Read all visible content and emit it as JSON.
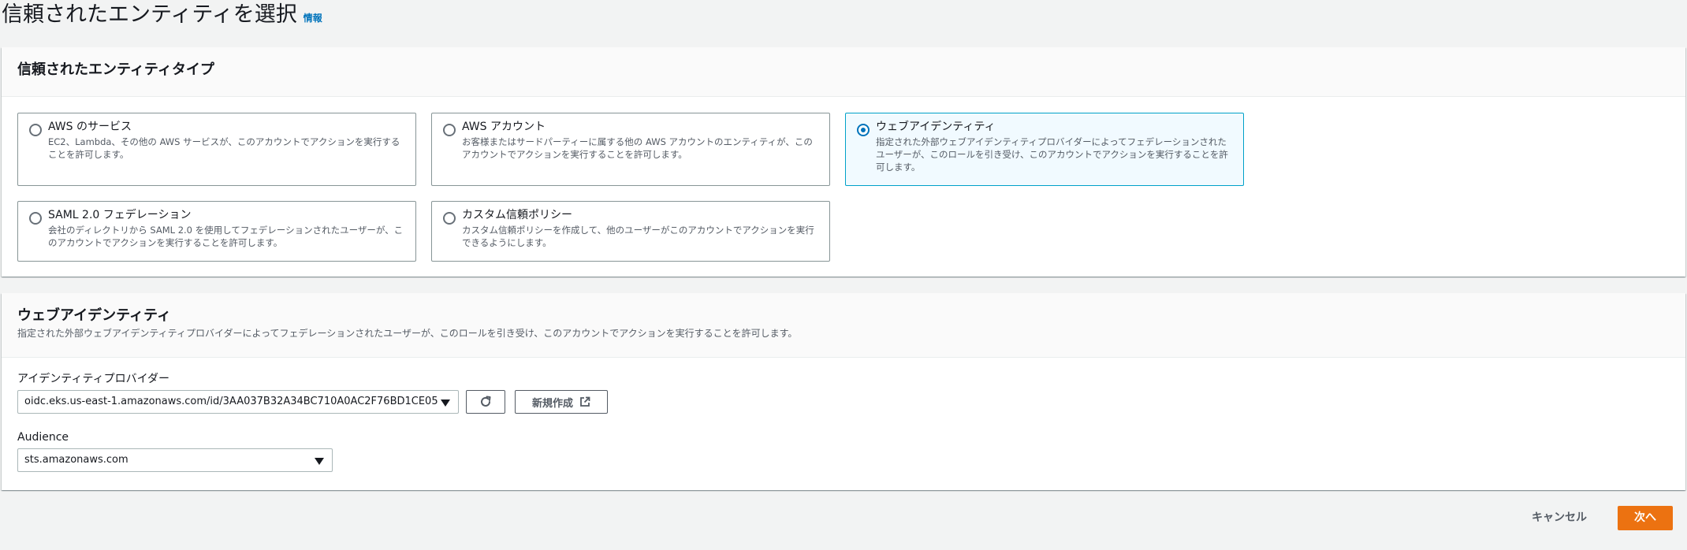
{
  "page": {
    "title": "信頼されたエンティティを選択",
    "info_link": "情報"
  },
  "entity_type": {
    "title": "信頼されたエンティティタイプ",
    "options": [
      {
        "label": "AWS のサービス",
        "description": "EC2、Lambda、その他の AWS サービスが、このアカウントでアクションを実行することを許可します。",
        "selected": false
      },
      {
        "label": "AWS アカウント",
        "description": "お客様またはサードパーティーに属する他の AWS アカウントのエンティティが、このアカウントでアクションを実行することを許可します。",
        "selected": false
      },
      {
        "label": "ウェブアイデンティティ",
        "description": "指定された外部ウェブアイデンティティプロバイダーによってフェデレーションされたユーザーが、このロールを引き受け、このアカウントでアクションを実行することを許可します。",
        "selected": true
      },
      {
        "label": "SAML 2.0 フェデレーション",
        "description": "会社のディレクトリから SAML 2.0 を使用してフェデレーションされたユーザーが、このアカウントでアクションを実行することを許可します。",
        "selected": false
      },
      {
        "label": "カスタム信頼ポリシー",
        "description": "カスタム信頼ポリシーを作成して、他のユーザーがこのアカウントでアクションを実行できるようにします。",
        "selected": false
      }
    ]
  },
  "web_identity": {
    "title": "ウェブアイデンティティ",
    "description": "指定された外部ウェブアイデンティティプロバイダーによってフェデレーションされたユーザーが、このロールを引き受け、このアカウントでアクションを実行することを許可します。",
    "provider_label": "アイデンティティプロバイダー",
    "provider_value": "oidc.eks.us-east-1.amazonaws.com/id/3AA037B32A34BC710A0AC2F76BD1CE05",
    "new_button": "新規作成",
    "audience_label": "Audience",
    "audience_value": "sts.amazonaws.com"
  },
  "footer": {
    "cancel": "キャンセル",
    "next": "次へ"
  },
  "colors": {
    "accent": "#0073bb",
    "primary_button": "#ec7211",
    "selected_border": "#00a1c9",
    "selected_bg": "#f1faff"
  },
  "icons": {
    "refresh": "refresh-icon",
    "external_link": "external-link-icon",
    "dropdown": "caret-down-icon"
  }
}
